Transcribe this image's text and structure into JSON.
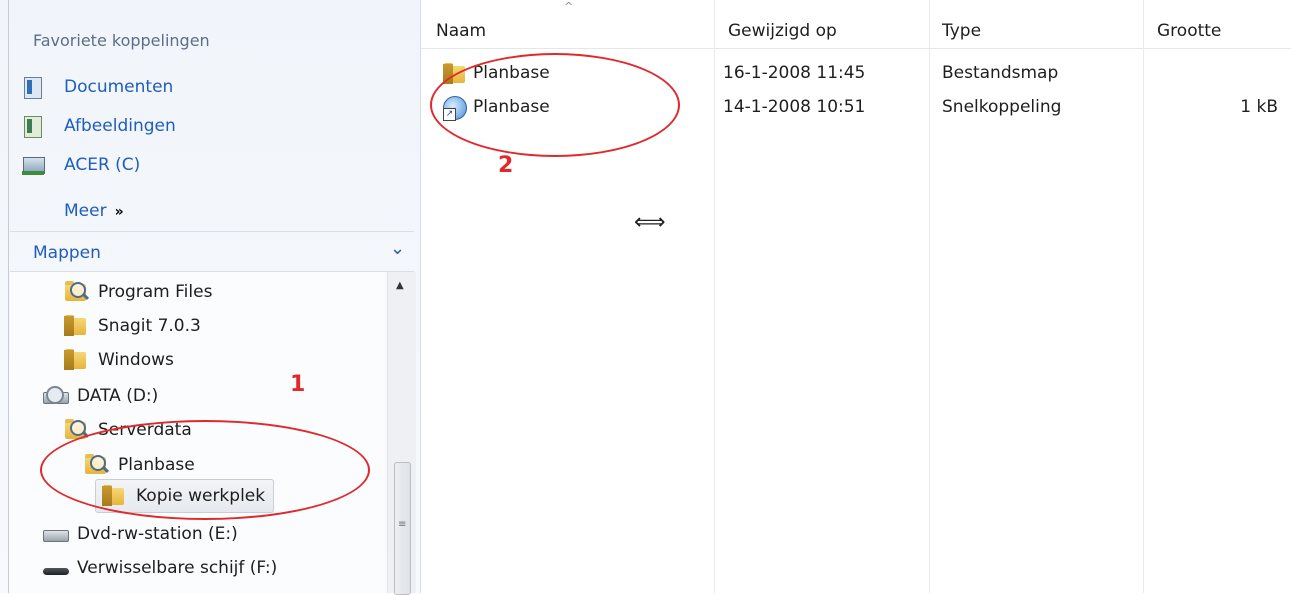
{
  "favorites": {
    "title": "Favoriete koppelingen",
    "items": [
      {
        "label": "Documenten",
        "icon": "documents-icon"
      },
      {
        "label": "Afbeeldingen",
        "icon": "pictures-icon"
      },
      {
        "label": "ACER (C)",
        "icon": "drive-c-icon"
      }
    ],
    "more": {
      "label": "Meer",
      "chevron": "»"
    }
  },
  "folders": {
    "title": "Mappen",
    "collapse_glyph": "⌄",
    "tree": [
      {
        "label": "Program Files",
        "icon": "search-folder-icon"
      },
      {
        "label": "Snagit 7.0.3",
        "icon": "folder-icon"
      },
      {
        "label": "Windows",
        "icon": "folder-icon"
      },
      {
        "label": "DATA (D:)",
        "icon": "network-drive-icon"
      },
      {
        "label": "Serverdata",
        "icon": "search-folder-icon"
      },
      {
        "label": "Planbase",
        "icon": "search-folder-icon"
      },
      {
        "label": "Kopie werkplek",
        "icon": "folder-icon",
        "selected": true
      },
      {
        "label": "Dvd-rw-station (E:)",
        "icon": "dvd-drive-icon"
      },
      {
        "label": "Verwisselbare schijf (F:)",
        "icon": "removable-drive-icon"
      }
    ]
  },
  "file_list": {
    "columns": [
      "Naam",
      "Gewijzigd op",
      "Type",
      "Grootte"
    ],
    "sort_indicator": "^",
    "rows": [
      {
        "name": "Planbase",
        "modified": "16-1-2008 11:45",
        "type": "Bestandsmap",
        "size": "",
        "icon": "folder-icon"
      },
      {
        "name": "Planbase",
        "modified": "14-1-2008 10:51",
        "type": "Snelkoppeling",
        "size": "1 kB",
        "icon": "shortcut-icon"
      }
    ]
  },
  "cursor_glyph": "⟺",
  "annotations": {
    "one": "1",
    "two": "2",
    "color": "#e1292b"
  },
  "colors": {
    "link": "#1f5dbf",
    "nav_bg": "#f1f5fb",
    "accent_red": "#e1292b"
  }
}
